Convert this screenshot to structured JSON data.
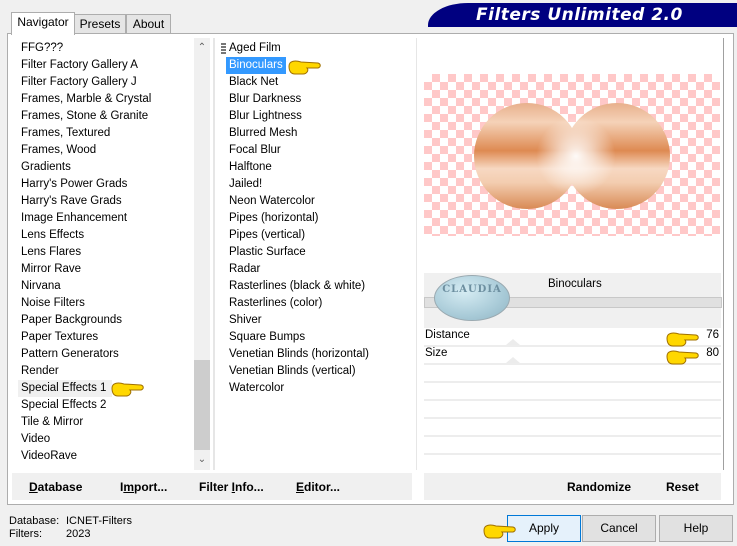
{
  "app": {
    "title": "Filters Unlimited 2.0"
  },
  "tabs": [
    {
      "label": "Navigator",
      "active": true
    },
    {
      "label": "Presets",
      "active": false
    },
    {
      "label": "About",
      "active": false
    }
  ],
  "categories": {
    "items": [
      "FFG???",
      "Filter Factory Gallery A",
      "Filter Factory Gallery J",
      "Frames, Marble & Crystal",
      "Frames, Stone & Granite",
      "Frames, Textured",
      "Frames, Wood",
      "Gradients",
      "Harry's Power Grads",
      "Harry's Rave Grads",
      "Image Enhancement",
      "Lens Effects",
      "Lens Flares",
      "Mirror Rave",
      "Nirvana",
      "Noise Filters",
      "Paper Backgrounds",
      "Paper Textures",
      "Pattern Generators",
      "Render",
      "Special Effects 1",
      "Special Effects 2",
      "Tile & Mirror",
      "Video",
      "VideoRave"
    ],
    "selected": "Special Effects 1"
  },
  "filters": {
    "items": [
      "Aged Film",
      "Binoculars",
      "Black Net",
      "Blur Darkness",
      "Blur Lightness",
      "Blurred Mesh",
      "Focal Blur",
      "Halftone",
      "Jailed!",
      "Neon Watercolor",
      "Pipes (horizontal)",
      "Pipes (vertical)",
      "Plastic Surface",
      "Radar",
      "Rasterlines (black & white)",
      "Rasterlines (color)",
      "Shiver",
      "Square Bumps",
      "Venetian Blinds (horizontal)",
      "Venetian Blinds (vertical)",
      "Watercolor"
    ],
    "selected": "Binoculars"
  },
  "preview": {
    "filter_name": "Binoculars",
    "logo_text": "CLAUDIA"
  },
  "parameters": [
    {
      "label": "Distance",
      "value": "76"
    },
    {
      "label": "Size",
      "value": "80"
    }
  ],
  "toolbar": {
    "database": {
      "pre": "",
      "u": "D",
      "post": "atabase"
    },
    "import": {
      "pre": "I",
      "u": "m",
      "post": "port..."
    },
    "filter_info": {
      "pre": "Filter ",
      "u": "I",
      "post": "nfo..."
    },
    "editor": {
      "pre": "",
      "u": "E",
      "post": "ditor..."
    },
    "randomize": "Randomize",
    "reset": "Reset"
  },
  "status": {
    "database_label": "Database:",
    "database_value": "ICNET-Filters",
    "filters_label": "Filters:",
    "filters_value": "2023"
  },
  "buttons": {
    "apply": "Apply",
    "cancel": "Cancel",
    "help": "Help"
  },
  "colors": {
    "banner": "#000080",
    "selection": "#3399ff",
    "checker": "#ffc8c8"
  }
}
